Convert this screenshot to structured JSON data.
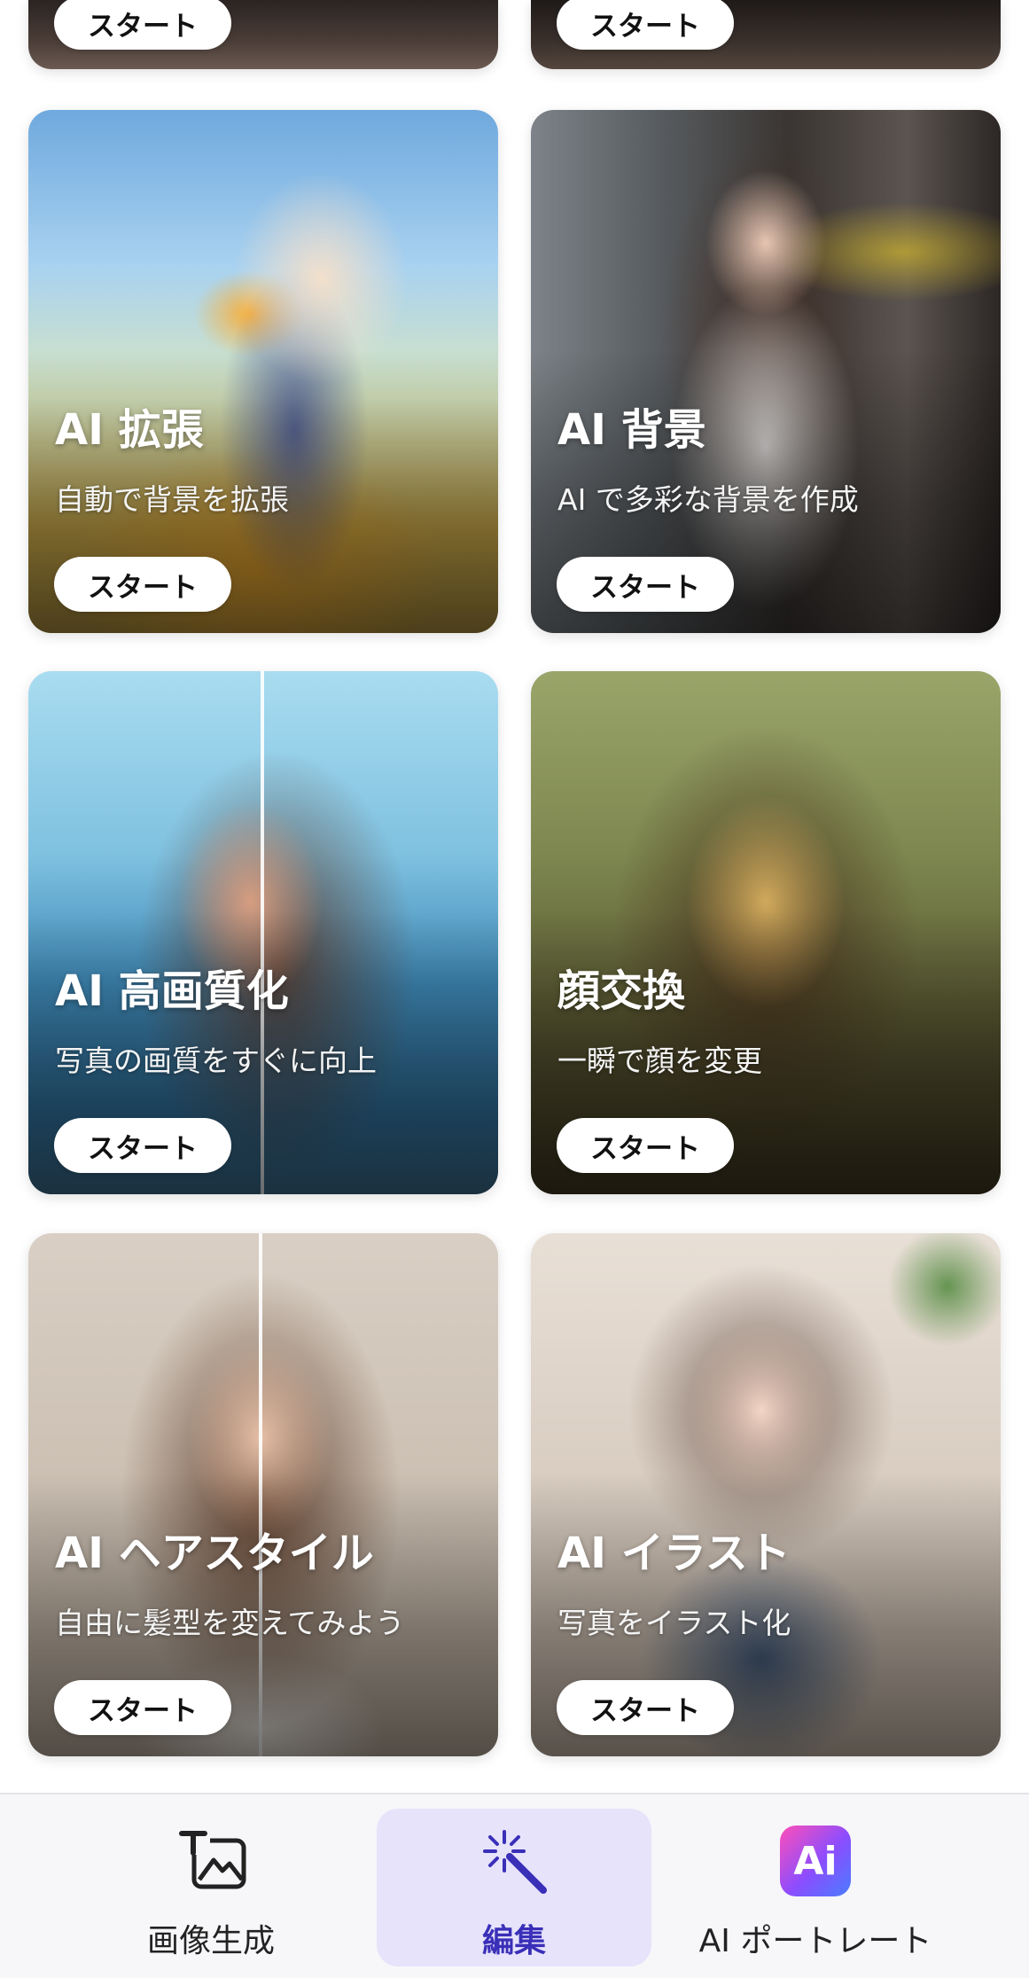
{
  "cards": [
    {
      "title": "",
      "desc": "",
      "start": "スタート"
    },
    {
      "title": "",
      "desc": "",
      "start": "スタート"
    },
    {
      "title": "AI 拡張",
      "desc": "自動で背景を拡張",
      "start": "スタート"
    },
    {
      "title": "AI 背景",
      "desc": "AI で多彩な背景を作成",
      "start": "スタート"
    },
    {
      "title": "AI 高画質化",
      "desc": "写真の画質をすぐに向上",
      "start": "スタート"
    },
    {
      "title": "顔交換",
      "desc": "一瞬で顔を変更",
      "start": "スタート"
    },
    {
      "title": "AI ヘアスタイル",
      "desc": "自由に髪型を変えてみよう",
      "start": "スタート"
    },
    {
      "title": "AI イラスト",
      "desc": "写真をイラスト化",
      "start": "スタート"
    }
  ],
  "nav": {
    "items": [
      {
        "label": "画像生成",
        "icon": "image-generate-icon"
      },
      {
        "label": "編集",
        "icon": "magic-wand-icon",
        "active": true
      },
      {
        "label": "AI ポートレート",
        "icon": "ai-portrait-icon",
        "badge": "Ai"
      }
    ]
  },
  "colors": {
    "accent": "#3a2fb8",
    "active_bg": "#e6e3fb"
  }
}
